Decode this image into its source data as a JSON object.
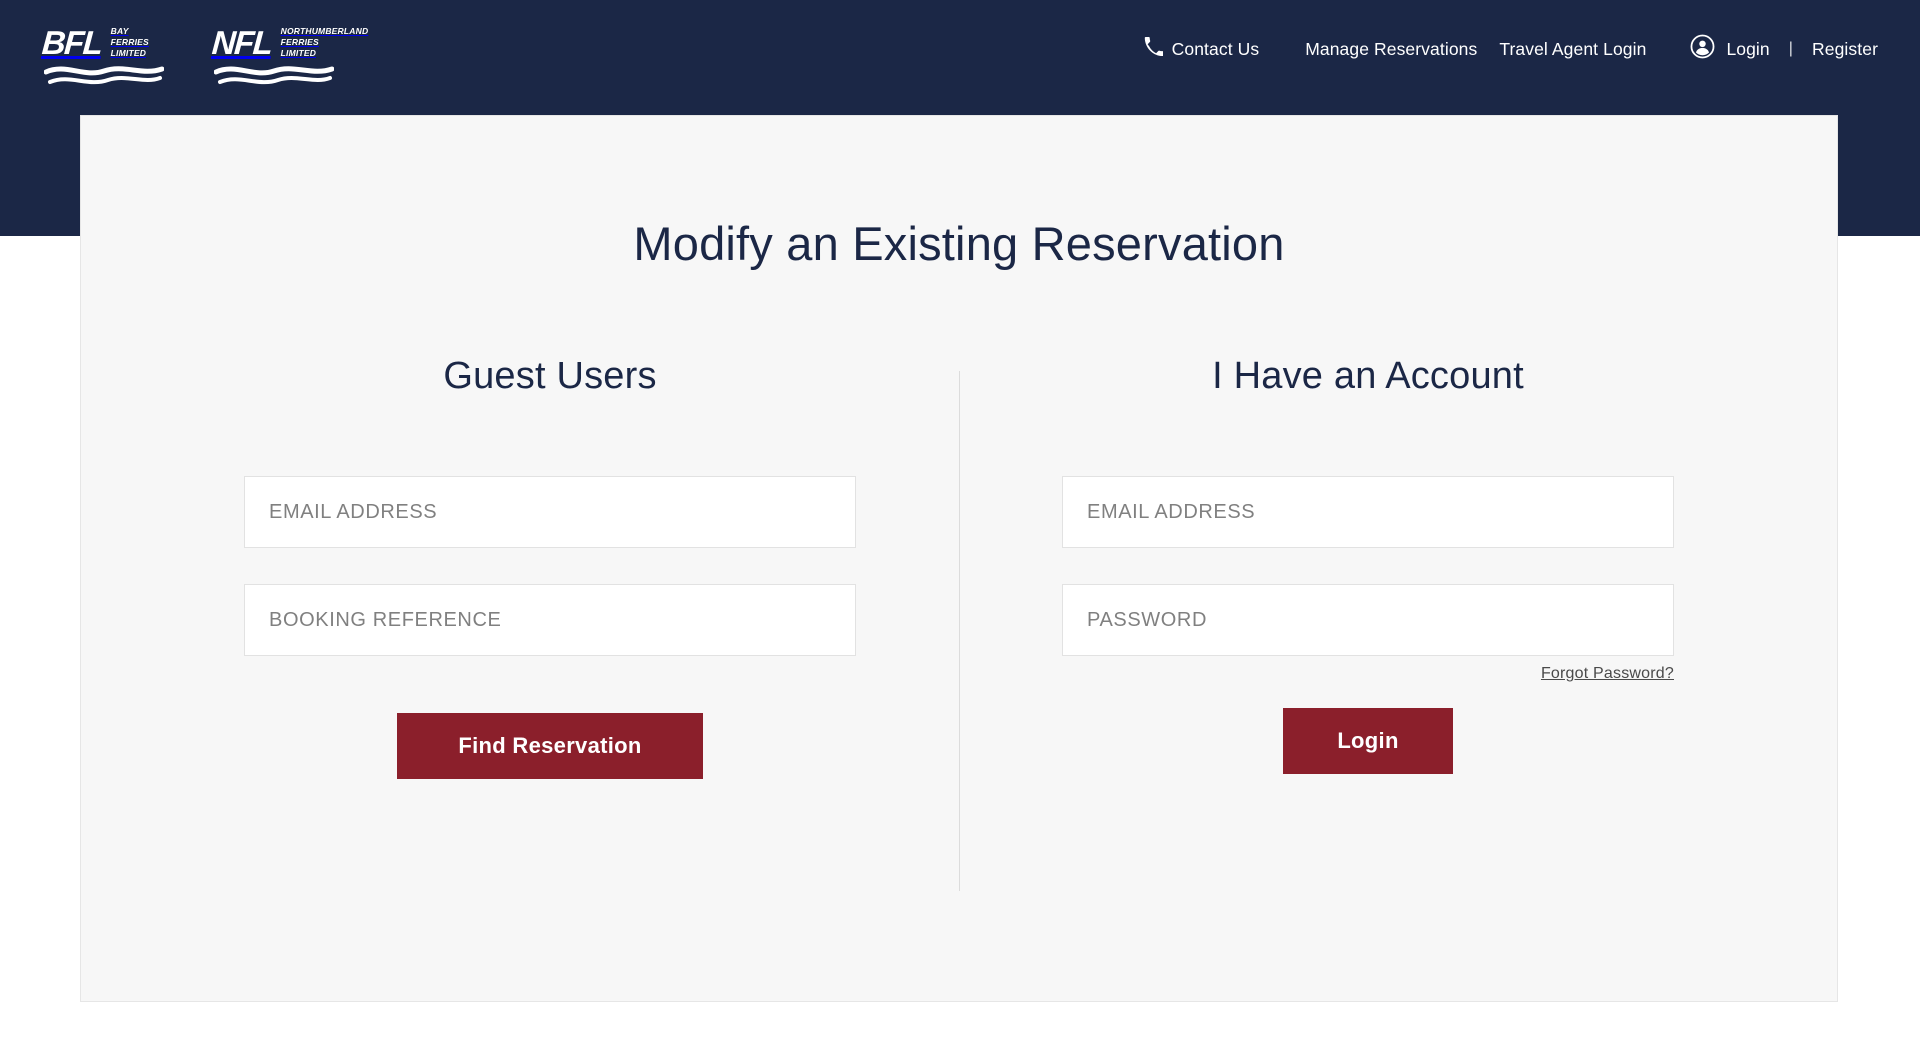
{
  "header": {
    "background_color": "#1b2746",
    "logos": [
      {
        "id": "bfl",
        "mark": "BFL",
        "icon_name": "bfl-logo",
        "words": [
          "BAY",
          "FERRIES",
          "LIMITED"
        ]
      },
      {
        "id": "nfl",
        "mark": "NFL",
        "icon_name": "nfl-logo",
        "words": [
          "NORTHUMBERLAND",
          "FERRIES",
          "LIMITED"
        ]
      }
    ],
    "nav": {
      "contact": {
        "label": "Contact Us",
        "icon": "phone-icon"
      },
      "manage": {
        "label": "Manage Reservations"
      },
      "travel_agent": {
        "label": "Travel Agent Login"
      },
      "account": {
        "icon": "user-circle-icon",
        "login_label": "Login",
        "separator": "|",
        "register_label": "Register"
      }
    }
  },
  "main": {
    "card_background": "#f7f7f7",
    "title": "Modify an Existing Reservation",
    "guest": {
      "heading": "Guest Users",
      "email": {
        "placeholder": "EMAIL ADDRESS",
        "value": ""
      },
      "booking_reference": {
        "placeholder": "BOOKING REFERENCE",
        "value": ""
      },
      "submit_label": "Find Reservation"
    },
    "account": {
      "heading": "I Have an Account",
      "email": {
        "placeholder": "EMAIL ADDRESS",
        "value": ""
      },
      "password": {
        "placeholder": "PASSWORD",
        "value": ""
      },
      "forgot_password_label": "Forgot Password?",
      "submit_label": "Login"
    }
  },
  "colors": {
    "navy": "#1b2746",
    "maroon": "#8b1f2b",
    "card_bg": "#f7f7f7",
    "input_border": "#e2e2e2",
    "placeholder": "#808080"
  }
}
